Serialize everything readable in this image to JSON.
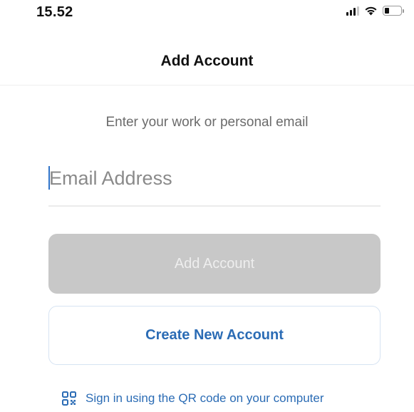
{
  "status_bar": {
    "time": "15.52",
    "icons": [
      "cellular-signal-icon",
      "wifi-icon",
      "battery-icon"
    ]
  },
  "nav": {
    "title": "Add Account"
  },
  "form": {
    "prompt": "Enter your work or personal email",
    "email_placeholder": "Email Address",
    "email_value": ""
  },
  "actions": {
    "add_account_label": "Add Account",
    "create_account_label": "Create New Account",
    "qr_signin_label": "Sign in using the QR code on your computer"
  },
  "colors": {
    "accent": "#2b6cb5",
    "disabled_button_bg": "#c8c8c8",
    "disabled_button_text": "#eeeeee",
    "prompt_text": "#6b6b6b",
    "divider": "#efefef"
  }
}
